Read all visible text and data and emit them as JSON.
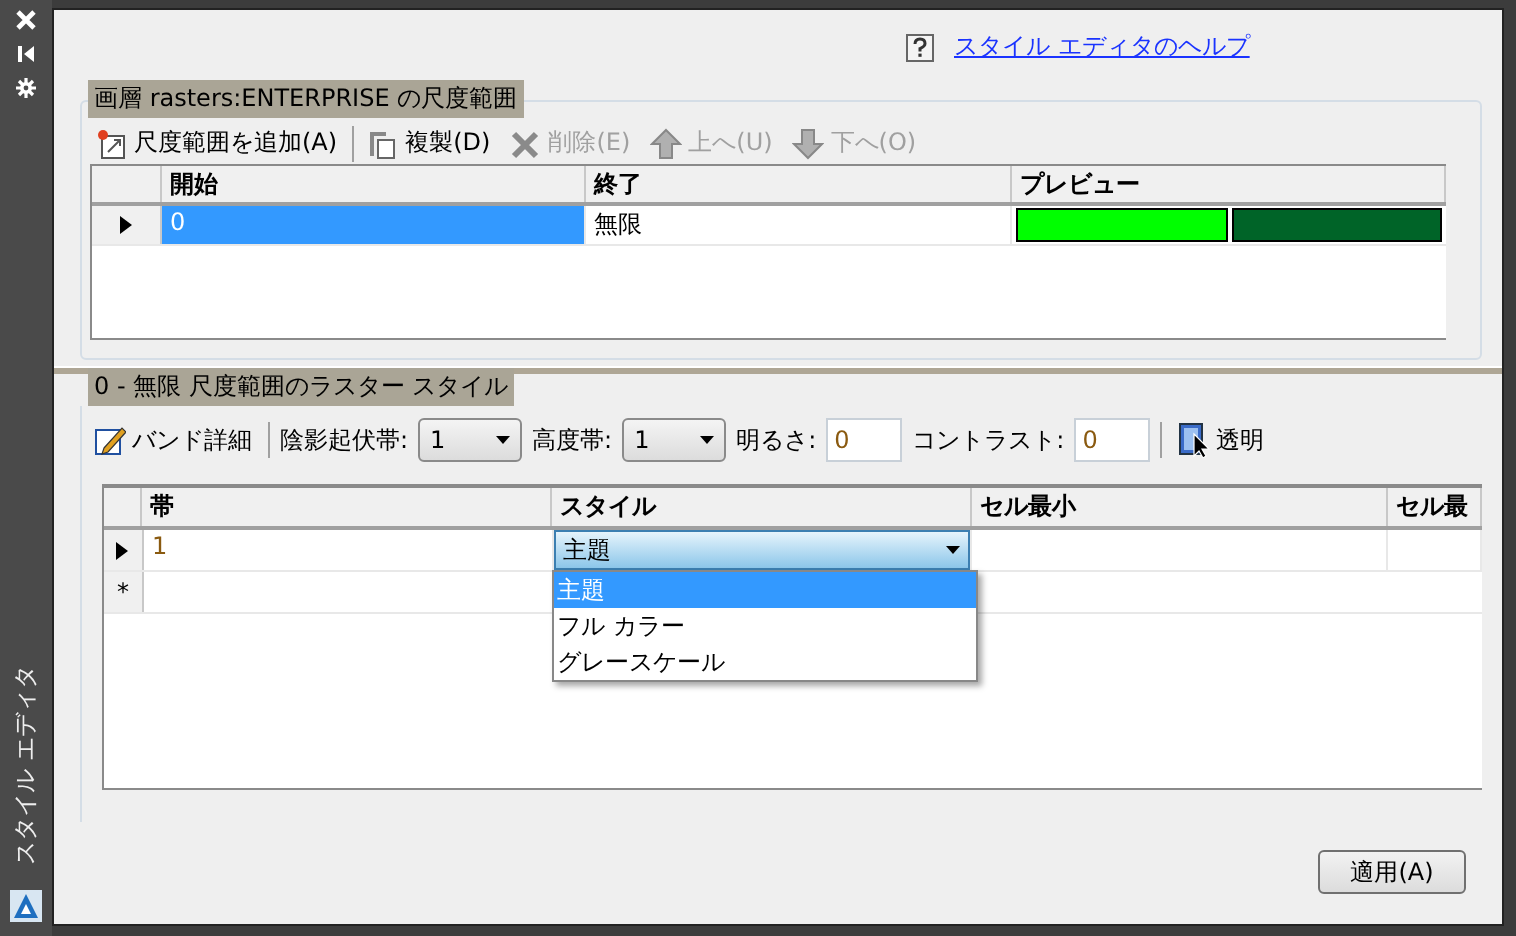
{
  "sidebar": {
    "title": "スタイル エディタ"
  },
  "help_link": "スタイル エディタのヘルプ",
  "scale_ranges": {
    "title": "画層 rasters:ENTERPRISE の尺度範囲",
    "toolbar": [
      {
        "kind": "add",
        "label": "尺度範囲を追加(A)",
        "disabled": false
      },
      {
        "kind": "copy",
        "label": "複製(D)",
        "disabled": false
      },
      {
        "kind": "delete",
        "label": "削除(E)",
        "disabled": true
      },
      {
        "kind": "up",
        "label": "上へ(U)",
        "disabled": true
      },
      {
        "kind": "down",
        "label": "下へ(O)",
        "disabled": true
      }
    ],
    "columns": [
      "開始",
      "終了",
      "プレビュー"
    ],
    "rows": [
      {
        "current": true,
        "start": "0",
        "selected": true,
        "end": "無限",
        "preview": [
          {
            "color": "#00ff00"
          },
          {
            "color": "#006428"
          }
        ]
      }
    ]
  },
  "raster_style": {
    "title": "0 - 無限 尺度範囲のラスター スタイル",
    "band_details": "バンド詳細",
    "hillshade": {
      "label": "陰影起伏帯:",
      "value": "1"
    },
    "elevation": {
      "label": "高度帯:",
      "value": "1"
    },
    "brightness": {
      "label": "明るさ:",
      "value": "0"
    },
    "contrast": {
      "label": "コントラスト:",
      "value": "0"
    },
    "transparent": "透明",
    "columns": [
      "帯",
      "スタイル",
      "セル最小",
      "セル最"
    ],
    "rows": [
      {
        "current": true,
        "band": "1",
        "style": "主題"
      }
    ],
    "new_row_marker": "*",
    "style_dropdown": {
      "expanded": true,
      "options": [
        {
          "label": "主題",
          "selected": true
        },
        {
          "label": "フル カラー",
          "selected": false
        },
        {
          "label": "グレースケール",
          "selected": false
        }
      ]
    }
  },
  "apply_button": "適用(A)"
}
